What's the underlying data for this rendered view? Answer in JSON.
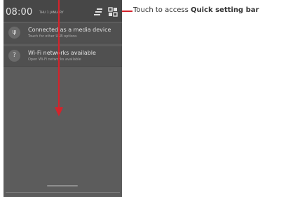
{
  "status_bar": {
    "time": "08:00",
    "date": "THU 1 JANUARY",
    "settings_icon": "equalizer-icon",
    "quick_settings_icon": "quick-settings-grid-icon"
  },
  "notifications": [
    {
      "icon": "usb-icon",
      "icon_glyph": "ψ",
      "title": "Connected as a media device",
      "subtitle": "Touch for other USB options"
    },
    {
      "icon": "wifi-icon",
      "icon_glyph": "?",
      "title": "Wi-Fi networks available",
      "subtitle": "Open Wi-Fi networks available"
    }
  ],
  "callout": {
    "prefix": "Touch to access ",
    "bold": "Quick setting bar"
  },
  "colors": {
    "panel": "#5c5c5c",
    "status_bar": "#474747",
    "notification": "#505050",
    "arrow": "#d4232b"
  }
}
